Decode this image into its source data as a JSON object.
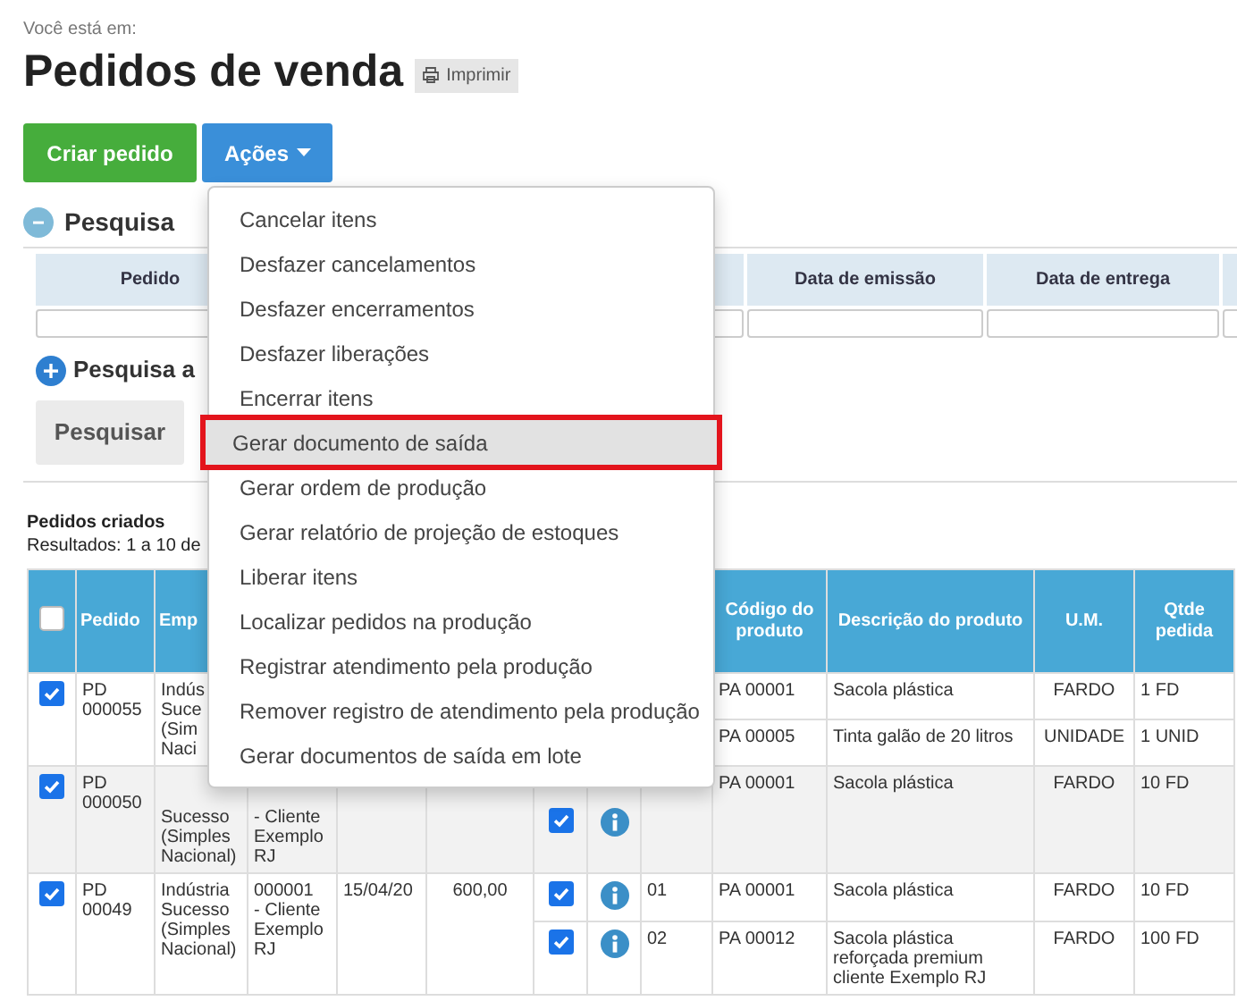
{
  "breadcrumb_label": "Você está em:",
  "title": "Pedidos de venda",
  "print_button": "Imprimir",
  "create_button": "Criar pedido",
  "actions_menu": {
    "label": "Ações",
    "expanded": true,
    "items": [
      {
        "label": "Cancelar itens",
        "selected": false
      },
      {
        "label": "Desfazer cancelamentos",
        "selected": false
      },
      {
        "label": "Desfazer encerramentos",
        "selected": false
      },
      {
        "label": "Desfazer liberações",
        "selected": false
      },
      {
        "label": "Encerrar itens",
        "selected": false
      },
      {
        "label": "Gerar documento de saída",
        "selected": true
      },
      {
        "label": "Gerar ordem de produção",
        "selected": false
      },
      {
        "label": "Gerar relatório de projeção de estoques",
        "selected": false
      },
      {
        "label": "Liberar itens",
        "selected": false
      },
      {
        "label": "Localizar pedidos na produção",
        "selected": false
      },
      {
        "label": "Registrar atendimento pela produção",
        "selected": false
      },
      {
        "label": "Remover registro de atendimento pela produção",
        "selected": false
      },
      {
        "label": "Gerar documentos de saída em lote",
        "selected": false
      }
    ]
  },
  "search": {
    "title": "Pesquisa",
    "expanded": true,
    "columns": [
      "Pedido",
      "Data de emissão",
      "Data de entrega"
    ]
  },
  "advanced_search": {
    "title": "Pesquisa a",
    "expanded": false
  },
  "search_button": "Pesquisar",
  "results": {
    "title": "Pedidos criados",
    "summary": "Resultados: 1 a 10 de",
    "select_all": false,
    "columns": [
      "Pedido",
      "Emp",
      "Código do produto",
      "Descrição do produto",
      "U.M.",
      "Qtde pedida"
    ],
    "orders": [
      {
        "checked": true,
        "pedido": "PD\n000055",
        "empresa": "Indús\nSuce\n(Sim\nNaci",
        "items": [
          {
            "codigo": "PA 00001",
            "descricao": "Sacola plástica",
            "um": "FARDO",
            "qtde": "1 FD"
          },
          {
            "codigo": "PA 00005",
            "descricao": "Tinta galão de 20 litros",
            "um": "UNIDADE",
            "qtde": "1 UNID"
          }
        ]
      },
      {
        "checked": true,
        "pedido": "PD\n000050",
        "empresa": "Sucesso\n(Simples\nNacional)",
        "cliente": "- Cliente\nExemplo\nRJ",
        "items": [
          {
            "checked": true,
            "info": true,
            "codigo": "PA 00001",
            "descricao": "Sacola plástica",
            "um": "FARDO",
            "qtde": "10 FD"
          }
        ]
      },
      {
        "checked": true,
        "pedido": "PD\n00049",
        "empresa": "Indústria\nSucesso\n(Simples\nNacional)",
        "cliente": "000001\n- Cliente\nExemplo\nRJ",
        "data": "15/04/20",
        "valor": "600,00",
        "items": [
          {
            "checked": true,
            "info": true,
            "item": "01",
            "codigo": "PA 00001",
            "descricao": "Sacola plástica",
            "um": "FARDO",
            "qtde": "10 FD"
          },
          {
            "checked": true,
            "info": true,
            "item": "02",
            "codigo": "PA 00012",
            "descricao": "Sacola plástica reforçada premium cliente Exemplo RJ",
            "um": "FARDO",
            "qtde": "100 FD"
          }
        ]
      }
    ]
  }
}
